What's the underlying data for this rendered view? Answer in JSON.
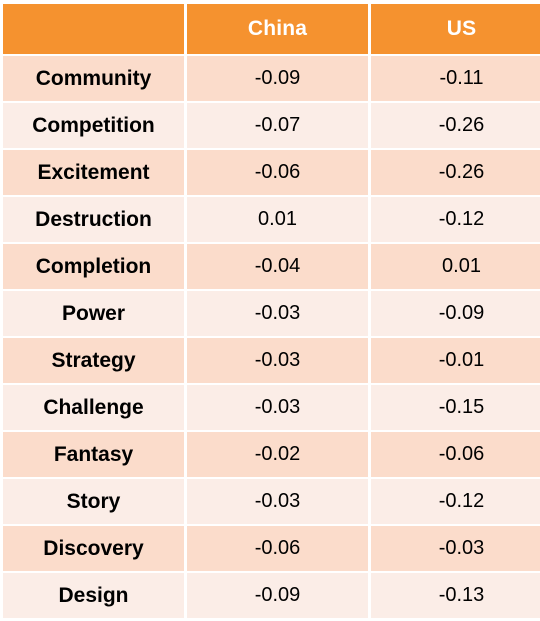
{
  "table": {
    "headers": [
      "",
      "China",
      "US"
    ],
    "rows": [
      {
        "label": "Community",
        "china": "-0.09",
        "us": "-0.11"
      },
      {
        "label": "Competition",
        "china": "-0.07",
        "us": "-0.26"
      },
      {
        "label": "Excitement",
        "china": "-0.06",
        "us": "-0.26"
      },
      {
        "label": "Destruction",
        "china": "0.01",
        "us": "-0.12"
      },
      {
        "label": "Completion",
        "china": "-0.04",
        "us": "0.01"
      },
      {
        "label": "Power",
        "china": "-0.03",
        "us": "-0.09"
      },
      {
        "label": "Strategy",
        "china": "-0.03",
        "us": "-0.01"
      },
      {
        "label": "Challenge",
        "china": "-0.03",
        "us": "-0.15"
      },
      {
        "label": "Fantasy",
        "china": "-0.02",
        "us": "-0.06"
      },
      {
        "label": "Story",
        "china": "-0.03",
        "us": "-0.12"
      },
      {
        "label": "Discovery",
        "china": "-0.06",
        "us": "-0.03"
      },
      {
        "label": "Design",
        "china": "-0.09",
        "us": "-0.13"
      }
    ]
  },
  "colors": {
    "header_background": "#F5922F",
    "header_text": "#FFFFFF",
    "row_dark": "#FBDCCB",
    "row_light": "#FBEDE7",
    "body_text": "#000000",
    "page_background": "#FFFFFF"
  },
  "chart_data": {
    "type": "table",
    "title": "",
    "categories": [
      "Community",
      "Competition",
      "Excitement",
      "Destruction",
      "Completion",
      "Power",
      "Strategy",
      "Challenge",
      "Fantasy",
      "Story",
      "Discovery",
      "Design"
    ],
    "series": [
      {
        "name": "China",
        "values": [
          -0.09,
          -0.07,
          -0.06,
          0.01,
          -0.04,
          -0.03,
          -0.03,
          -0.03,
          -0.02,
          -0.03,
          -0.06,
          -0.09
        ]
      },
      {
        "name": "US",
        "values": [
          -0.11,
          -0.26,
          -0.26,
          -0.12,
          0.01,
          -0.09,
          -0.01,
          -0.15,
          -0.06,
          -0.12,
          -0.03,
          -0.13
        ]
      }
    ],
    "xlabel": "",
    "ylabel": "",
    "legend": [
      "China",
      "US"
    ]
  }
}
